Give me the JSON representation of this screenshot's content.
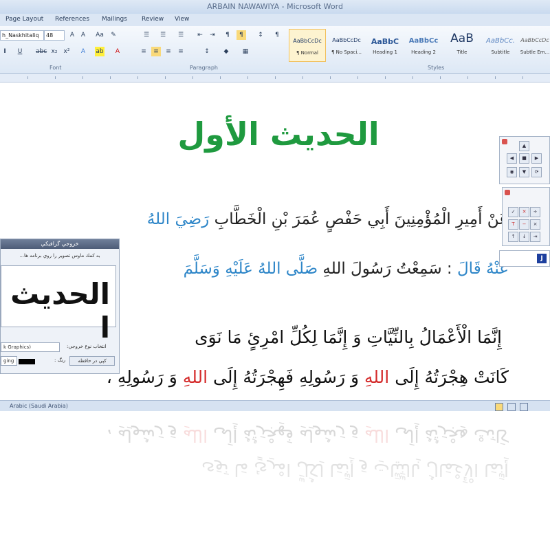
{
  "window": {
    "title": "ARBAIN NAWAWIYA - Microsoft Word"
  },
  "tabs": [
    "Page Layout",
    "References",
    "Mailings",
    "Review",
    "View"
  ],
  "ribbon": {
    "font_name": "_Naskh Naskh_Naskhitaliq",
    "font_name_display": "h_Naskhitaliq",
    "font_size": "48",
    "groups": {
      "font": "Font",
      "paragraph": "Paragraph",
      "styles": "Styles"
    },
    "styles": [
      {
        "preview": "AaBbCcDc",
        "name": "¶ Normal"
      },
      {
        "preview": "AaBbCcDc",
        "name": "¶ No Spaci..."
      },
      {
        "preview": "AaBbC",
        "name": "Heading 1"
      },
      {
        "preview": "AaBbCc",
        "name": "Heading 2"
      },
      {
        "preview": "AaB",
        "name": "Title"
      },
      {
        "preview": "AaBbCc.",
        "name": "Subtitle"
      },
      {
        "preview": "AaBbCcDc",
        "name": "Subtle Em..."
      }
    ]
  },
  "document": {
    "heading": "الحديث الأول",
    "line1_a": "عَنْ أَمِيرِ الْمُؤْمِنِينَ أَبِي حَفْصٍ عُمَرَ بْنِ الْخَطَّابِ ",
    "line1_b": "رَضِيَ اللهُ",
    "line2_a": "عَنْهُ قَالَ",
    "line2_b": " : سَمِعْتُ رَسُولَ اللهِ ",
    "line2_c": "صَلَّى اللهُ عَلَيْهِ وَسَلَّمَ",
    "line3": "إِنَّمَا الْأَعْمَالُ بِالنِّيَّاتِ وَ إِنَّمَا لِكُلِّ امْرِئٍ مَا نَوَى",
    "line4_a": "كَانَتْ هِجْرَتُهُ إِلَى ",
    "line4_b": "اللهِ",
    "line4_c": " وَ رَسُولِهِ فَهِجْرَتُهُ إِلَى ",
    "line4_d": "اللهِ",
    "line4_e": " وَ رَسُولِهِ ،"
  },
  "panel": {
    "title": "خروجي گرافيكي",
    "hint": "به كمك ماوس تصوير را روي برنامه ها...",
    "preview_text": "الحديث ا",
    "output_type_label": "انتخاب نوع خروجي:",
    "output_type_value": "k Graphics)",
    "color_label": "رنگ :",
    "save_button": "كپي در حافظه",
    "size_value": "ging"
  },
  "status": {
    "language": "Arabic (Saudi Arabia)"
  },
  "colors": {
    "heading_green": "#1f9a3f",
    "honorific_blue": "#2e86c8",
    "allah_red": "#d42a2a"
  }
}
